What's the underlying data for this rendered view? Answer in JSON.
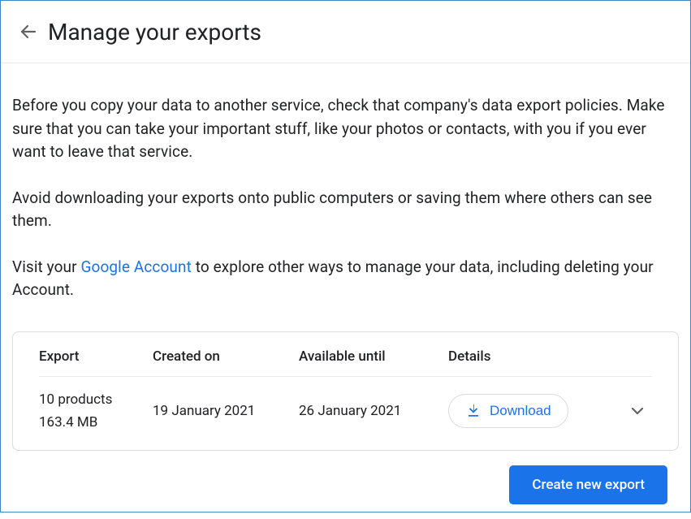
{
  "header": {
    "title": "Manage your exports"
  },
  "intro": {
    "p1": "Before you copy your data to another service, check that company's data export policies. Make sure that you can take your important stuff, like your photos or contacts, with you if you ever want to leave that service.",
    "p2": "Avoid downloading your exports onto public computers or saving them where others can see them.",
    "p3_pre": "Visit your ",
    "p3_link": "Google Account",
    "p3_post": " to explore other ways to manage your data, including deleting your Account."
  },
  "table": {
    "headers": {
      "export": "Export",
      "created": "Created on",
      "available": "Available until",
      "details": "Details"
    },
    "row": {
      "products": "10 products",
      "size": "163.4 MB",
      "created": "19 January 2021",
      "available": "26 January 2021",
      "download_label": "Download"
    }
  },
  "actions": {
    "create_new": "Create new export"
  }
}
